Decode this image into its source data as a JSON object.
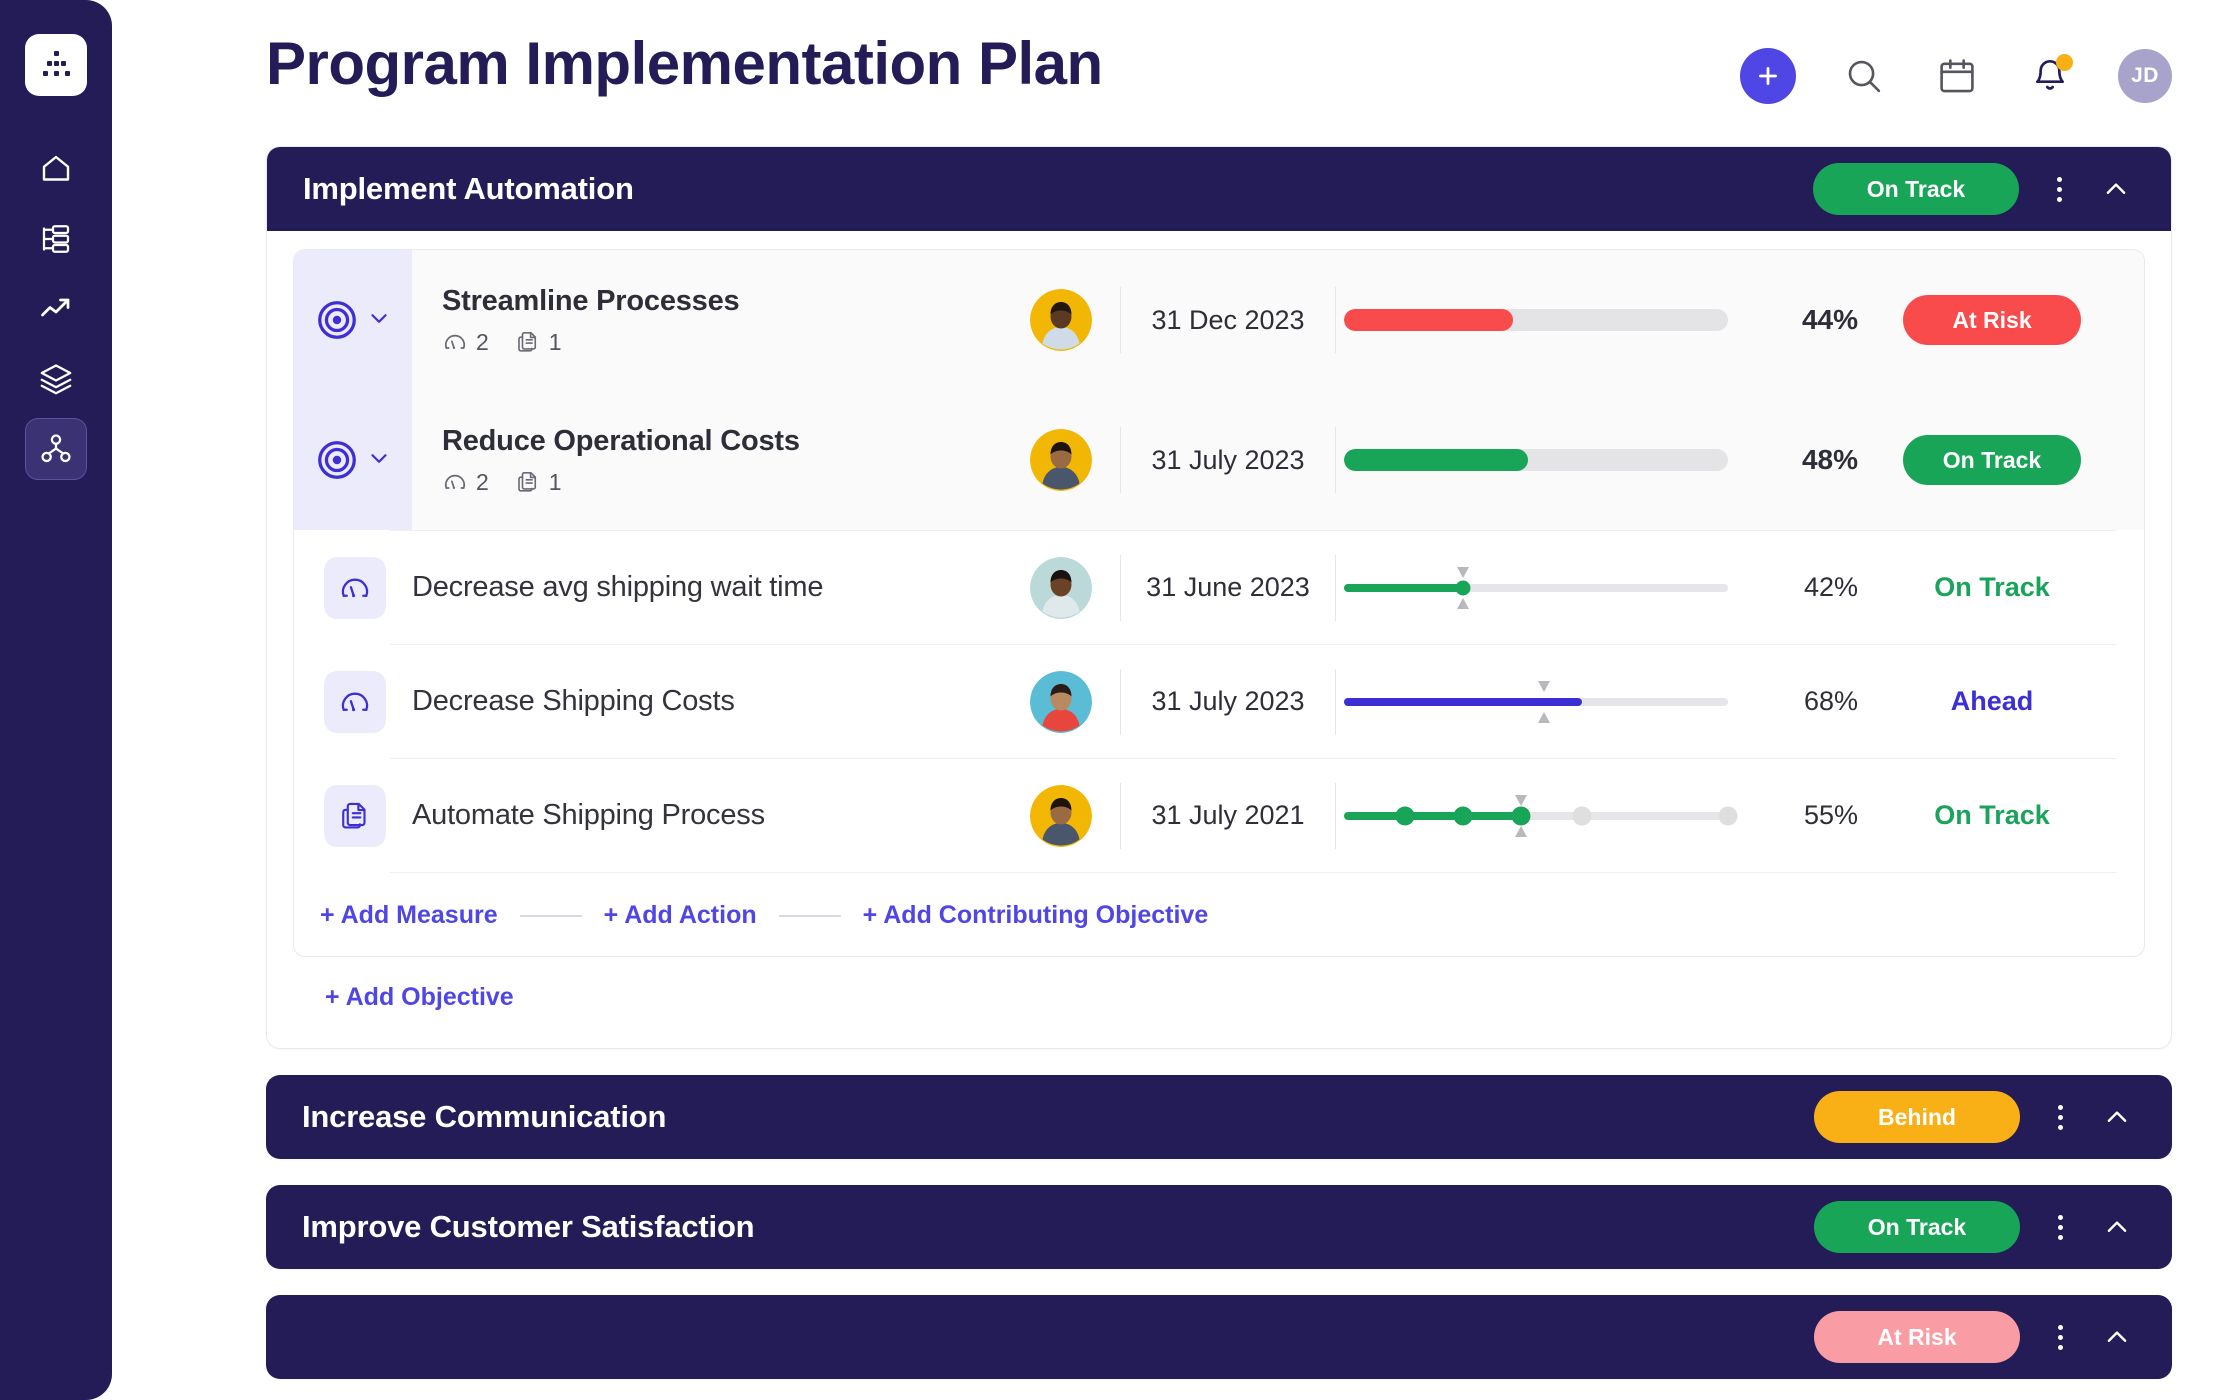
{
  "sidebar": {
    "logo": "org-chart-logo",
    "items": [
      {
        "name": "home",
        "icon": "home-icon",
        "active": false
      },
      {
        "name": "list",
        "icon": "list-tree-icon",
        "active": false
      },
      {
        "name": "analytics",
        "icon": "trending-up-icon",
        "active": false
      },
      {
        "name": "layers",
        "icon": "layers-icon",
        "active": false
      },
      {
        "name": "network",
        "icon": "share-network-icon",
        "active": true
      }
    ]
  },
  "header": {
    "title": "Program Implementation Plan",
    "add_button": "add-icon",
    "search": "search-icon",
    "calendar": "calendar-icon",
    "notifications": "bell-icon",
    "avatar_initials": "JD"
  },
  "colors": {
    "navy": "#231c57",
    "purple": "#4f46e5",
    "green": "#18a558",
    "green_text": "#1aa35a",
    "red": "#f94b4b",
    "amber": "#f9b016",
    "pink": "#f99ca4",
    "track": "#e4e4e7"
  },
  "objectives": [
    {
      "title": "Implement Automation",
      "status": "On Track",
      "status_color": "#18a558",
      "expanded": true,
      "rows": [
        {
          "type": "objective",
          "icon": "target-icon",
          "name": "Streamline Processes",
          "measures_count": "2",
          "actions_count": "1",
          "avatar": "avatar-male-yellow",
          "date": "31 Dec 2023",
          "progress": 44,
          "percent": "44%",
          "bar_color": "#f94b4b",
          "status": "At Risk",
          "status_style": "badge",
          "status_color": "#f94b4b"
        },
        {
          "type": "objective",
          "icon": "target-icon",
          "name": "Reduce Operational Costs",
          "measures_count": "2",
          "actions_count": "1",
          "avatar": "avatar-male-yellow2",
          "date": "31 July 2023",
          "progress": 48,
          "percent": "48%",
          "bar_color": "#18a558",
          "status": "On Track",
          "status_style": "badge",
          "status_color": "#18a558"
        },
        {
          "type": "measure",
          "icon": "gauge-icon",
          "name": "Decrease avg shipping wait time",
          "avatar": "avatar-female-teal",
          "date": "31 June 2023",
          "progress": 31,
          "target": 31,
          "percent": "42%",
          "bar_color": "#18a558",
          "status": "On Track",
          "status_style": "text",
          "status_color": "#1aa35a",
          "slider": "knob"
        },
        {
          "type": "measure",
          "icon": "gauge-icon",
          "name": "Decrease Shipping Costs",
          "avatar": "avatar-male-blue",
          "date": "31 July 2023",
          "progress": 62,
          "target": 52,
          "percent": "68%",
          "bar_color": "#3c2fd4",
          "status": "Ahead",
          "status_style": "text",
          "status_color": "#3c2fd4",
          "slider": "plain"
        },
        {
          "type": "action",
          "icon": "document-stack-icon",
          "name": "Automate Shipping Process",
          "avatar": "avatar-male-yellow3",
          "date": "31 July 2021",
          "progress": 46,
          "target": 46,
          "percent": "55%",
          "bar_color": "#18a558",
          "status": "On Track",
          "status_style": "text",
          "status_color": "#1aa35a",
          "slider": "milestones",
          "milestones": [
            {
              "pos": 16,
              "done": true
            },
            {
              "pos": 31,
              "done": true
            },
            {
              "pos": 46,
              "done": true
            },
            {
              "pos": 62,
              "done": false
            },
            {
              "pos": 100,
              "done": false
            }
          ]
        }
      ],
      "add_links": [
        "+ Add Measure",
        "+ Add Action",
        "+ Add Contributing Objective"
      ],
      "add_objective": "+ Add Objective"
    },
    {
      "title": "Increase Communication",
      "status": "Behind",
      "status_color": "#f9b016",
      "expanded": false,
      "rows": [],
      "add_links": [],
      "add_objective": ""
    },
    {
      "title": "Improve Customer Satisfaction",
      "status": "On Track",
      "status_color": "#18a558",
      "expanded": false,
      "rows": [],
      "add_links": [],
      "add_objective": ""
    },
    {
      "title": "",
      "status": "At Risk",
      "status_color": "#f99ca4",
      "expanded": false,
      "rows": [],
      "add_links": [],
      "add_objective": ""
    }
  ]
}
